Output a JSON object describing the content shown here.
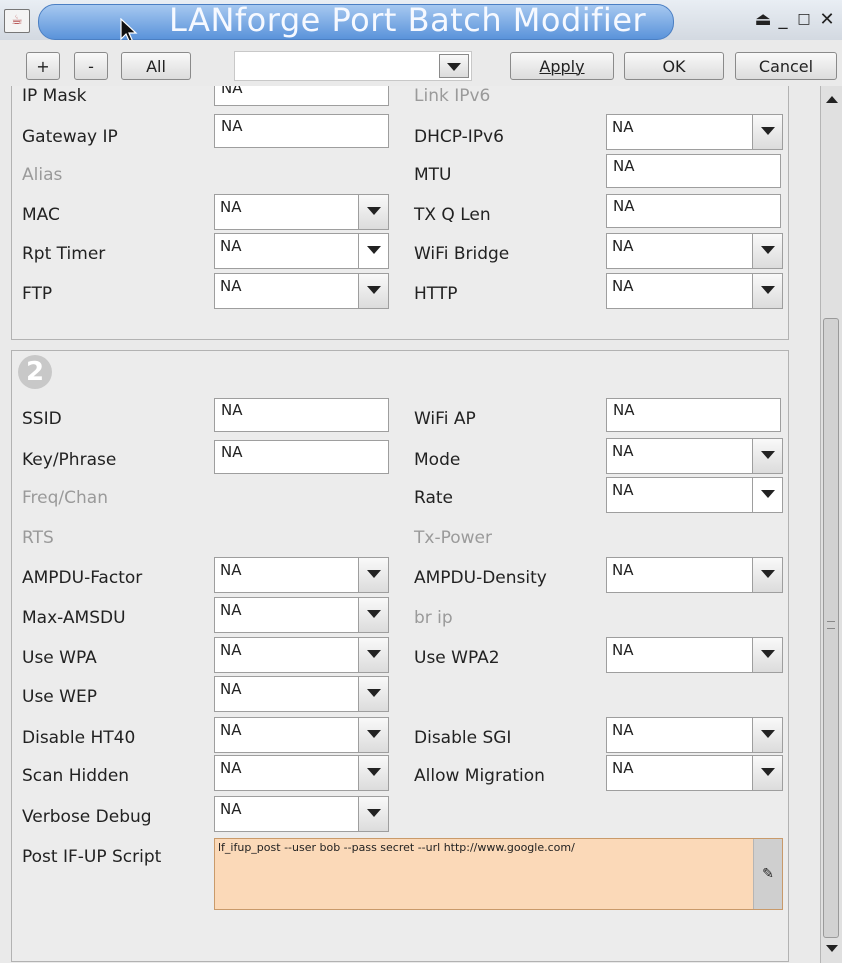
{
  "window": {
    "title": "LANforge Port Batch Modifier",
    "app_icon": "java-cup-icon",
    "controls": [
      "eject-icon",
      "minimize-icon",
      "maximize-icon",
      "close-icon"
    ],
    "accent": "#5a93da"
  },
  "toolbar": {
    "plus_label": "+",
    "minus_label": "-",
    "all_label": "All",
    "selector_value": "",
    "apply_label": "Apply",
    "ok_label": "OK",
    "cancel_label": "Cancel"
  },
  "section1": {
    "ip_mask": {
      "label": "IP Mask",
      "value": "NA"
    },
    "link_ipv6": {
      "label": "Link IPv6"
    },
    "gateway_ip": {
      "label": "Gateway IP",
      "value": "NA"
    },
    "dhcp_ipv6": {
      "label": "DHCP-IPv6",
      "value": "NA"
    },
    "alias": {
      "label": "Alias"
    },
    "mtu": {
      "label": "MTU",
      "value": "NA"
    },
    "mac": {
      "label": "MAC",
      "value": "NA"
    },
    "tx_q_len": {
      "label": "TX Q Len",
      "value": "NA"
    },
    "rpt_timer": {
      "label": "Rpt Timer",
      "value": "NA"
    },
    "wifi_bridge": {
      "label": "WiFi Bridge",
      "value": "NA"
    },
    "ftp": {
      "label": "FTP",
      "value": "NA"
    },
    "http": {
      "label": "HTTP",
      "value": "NA"
    }
  },
  "section2": {
    "badge": "2",
    "ssid": {
      "label": "SSID",
      "value": "NA"
    },
    "wifi_ap": {
      "label": "WiFi AP",
      "value": "NA"
    },
    "key_phrase": {
      "label": "Key/Phrase",
      "value": "NA"
    },
    "mode": {
      "label": "Mode",
      "value": "NA"
    },
    "freq_chan": {
      "label": "Freq/Chan"
    },
    "rate": {
      "label": "Rate",
      "value": "NA"
    },
    "rts": {
      "label": "RTS"
    },
    "tx_power": {
      "label": "Tx-Power"
    },
    "ampdu_factor": {
      "label": "AMPDU-Factor",
      "value": "NA"
    },
    "ampdu_density": {
      "label": "AMPDU-Density",
      "value": "NA"
    },
    "max_amsdu": {
      "label": "Max-AMSDU",
      "value": "NA"
    },
    "br_ip": {
      "label": "br ip"
    },
    "use_wpa": {
      "label": "Use WPA",
      "value": "NA"
    },
    "use_wpa2": {
      "label": "Use WPA2",
      "value": "NA"
    },
    "use_wep": {
      "label": "Use WEP",
      "value": "NA"
    },
    "disable_ht40": {
      "label": "Disable HT40",
      "value": "NA"
    },
    "disable_sgi": {
      "label": "Disable SGI",
      "value": "NA"
    },
    "scan_hidden": {
      "label": "Scan Hidden",
      "value": "NA"
    },
    "allow_migration": {
      "label": "Allow Migration",
      "value": "NA"
    },
    "verbose_debug": {
      "label": "Verbose Debug",
      "value": "NA"
    },
    "post_ifup_script": {
      "label": "Post IF-UP Script",
      "value": "lf_ifup_post --user bob --pass secret --url http://www.google.com/",
      "color": "#fbd9b8"
    }
  }
}
